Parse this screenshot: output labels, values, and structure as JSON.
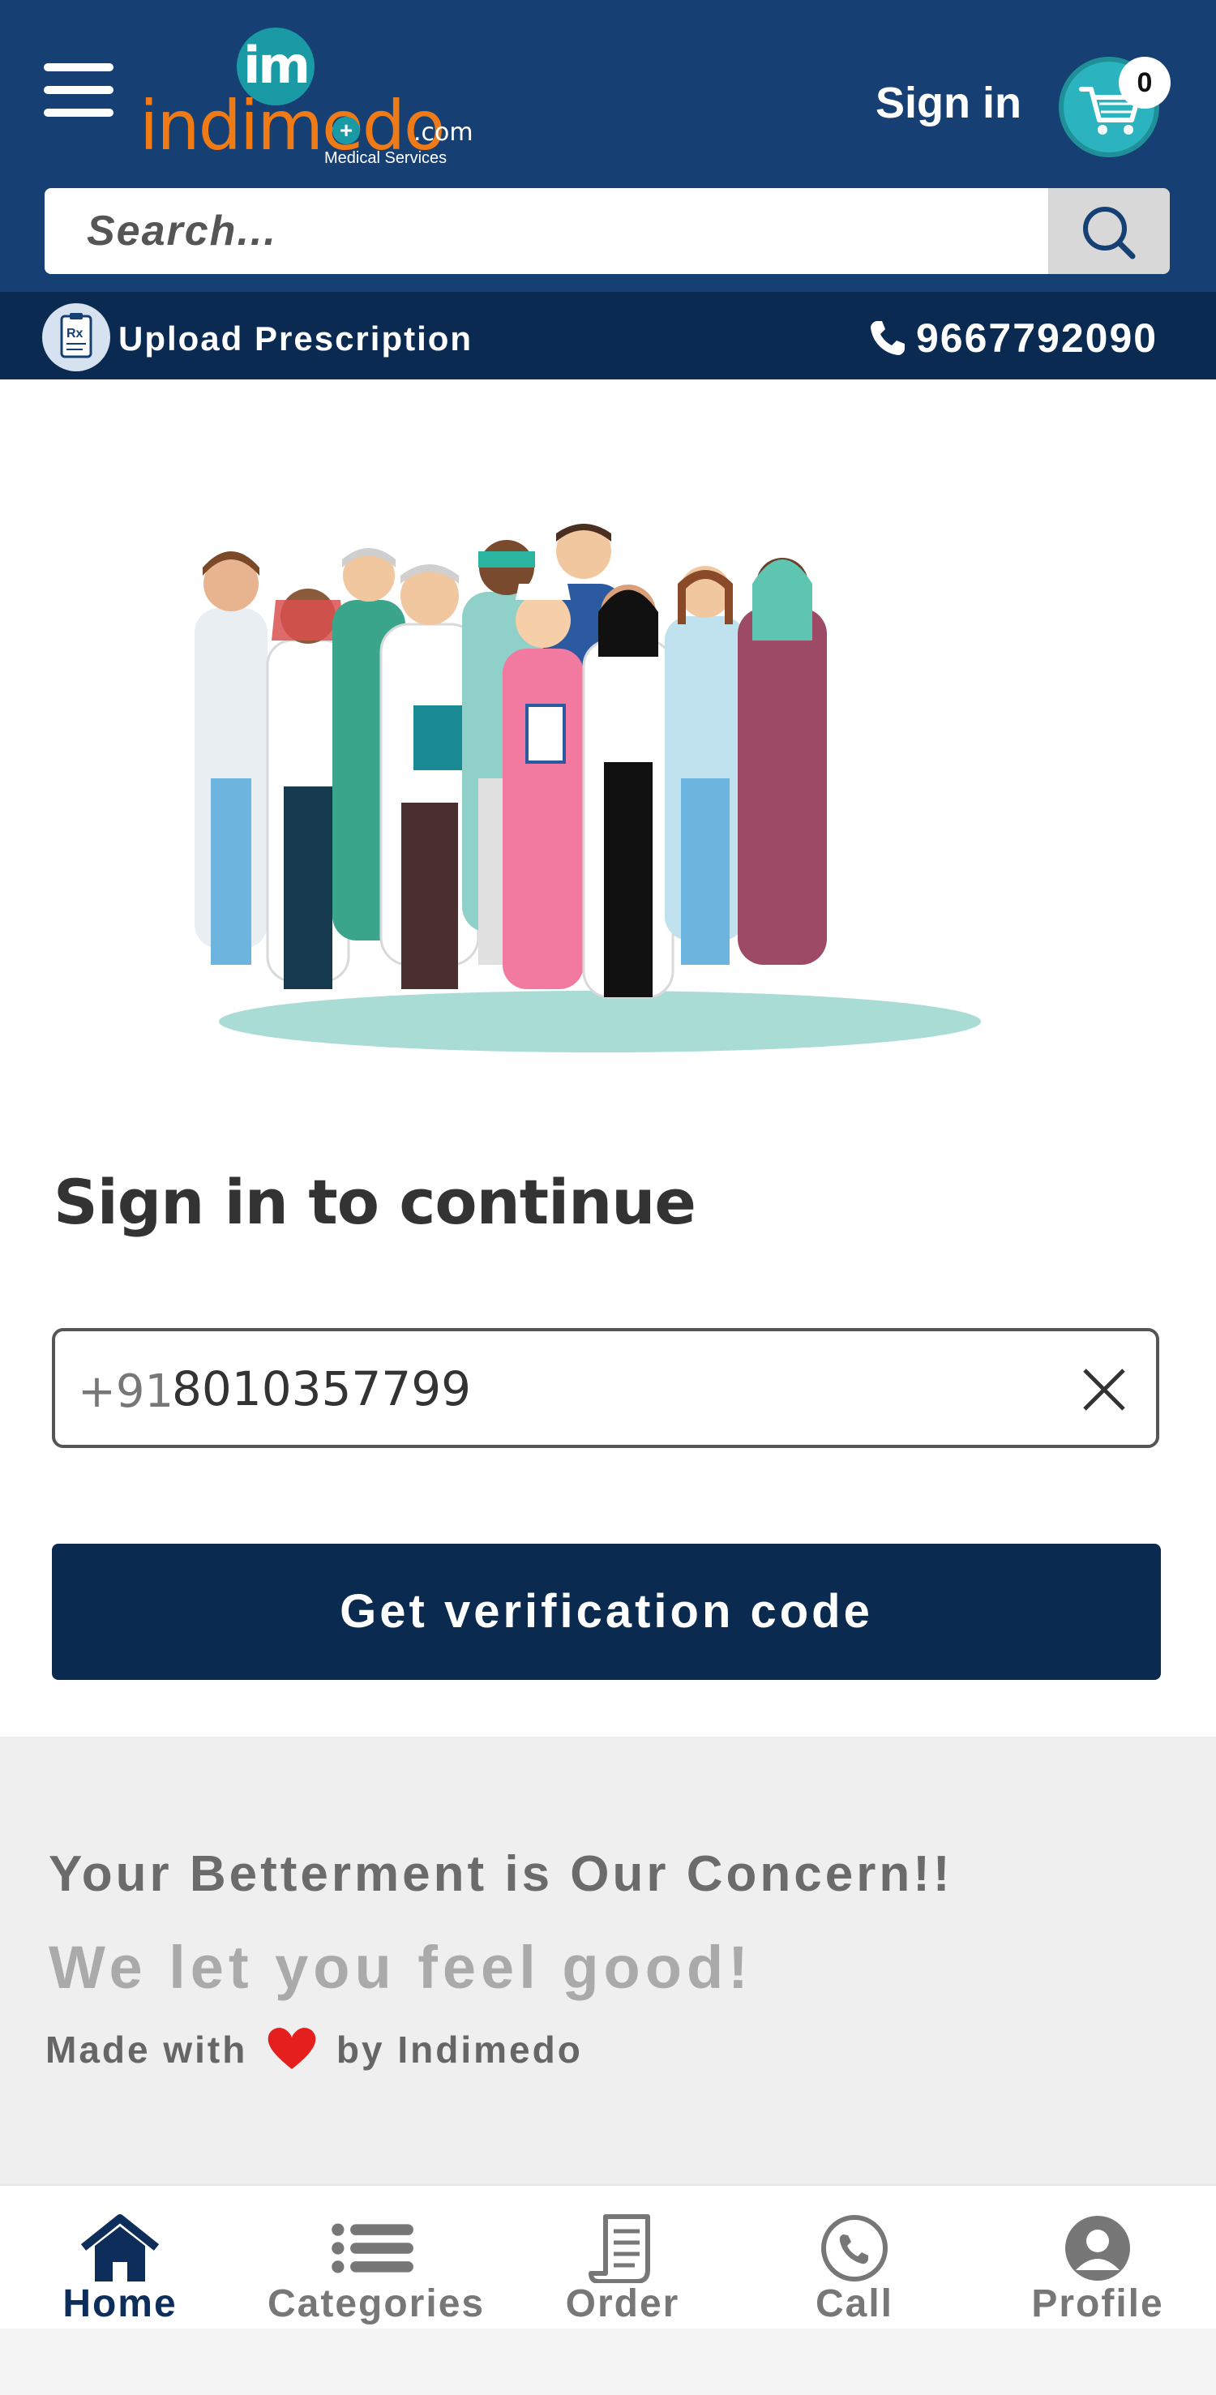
{
  "header": {
    "logo": {
      "badge": "im",
      "wordmark": "indimedo",
      "domain": ".com",
      "tagline": "Medical Services"
    },
    "signin_label": "Sign in",
    "cart_count": "0",
    "search_placeholder": "Search...",
    "upload_label": "Upload Prescription",
    "phone": "9667792090"
  },
  "main": {
    "title": "Sign in to continue",
    "country_code": "+91",
    "phone_value": "8010357799",
    "cta_label": "Get verification code"
  },
  "footer": {
    "tagline1": "Your Betterment is Our Concern!!",
    "tagline2": "We let you feel good!",
    "made_prefix": "Made with",
    "made_suffix": "by Indimedo"
  },
  "nav": {
    "items": [
      {
        "label": "Home",
        "icon": "home-icon",
        "active": true
      },
      {
        "label": "Categories",
        "icon": "list-icon",
        "active": false
      },
      {
        "label": "Order",
        "icon": "receipt-icon",
        "active": false
      },
      {
        "label": "Call",
        "icon": "phone-call-icon",
        "active": false
      },
      {
        "label": "Profile",
        "icon": "user-icon",
        "active": false
      }
    ]
  },
  "colors": {
    "header_bg": "#163f73",
    "subbar_bg": "#0a2a52",
    "brand_orange": "#f07b16",
    "brand_teal": "#1a9aa5",
    "cta_bg": "#0b2a50"
  }
}
